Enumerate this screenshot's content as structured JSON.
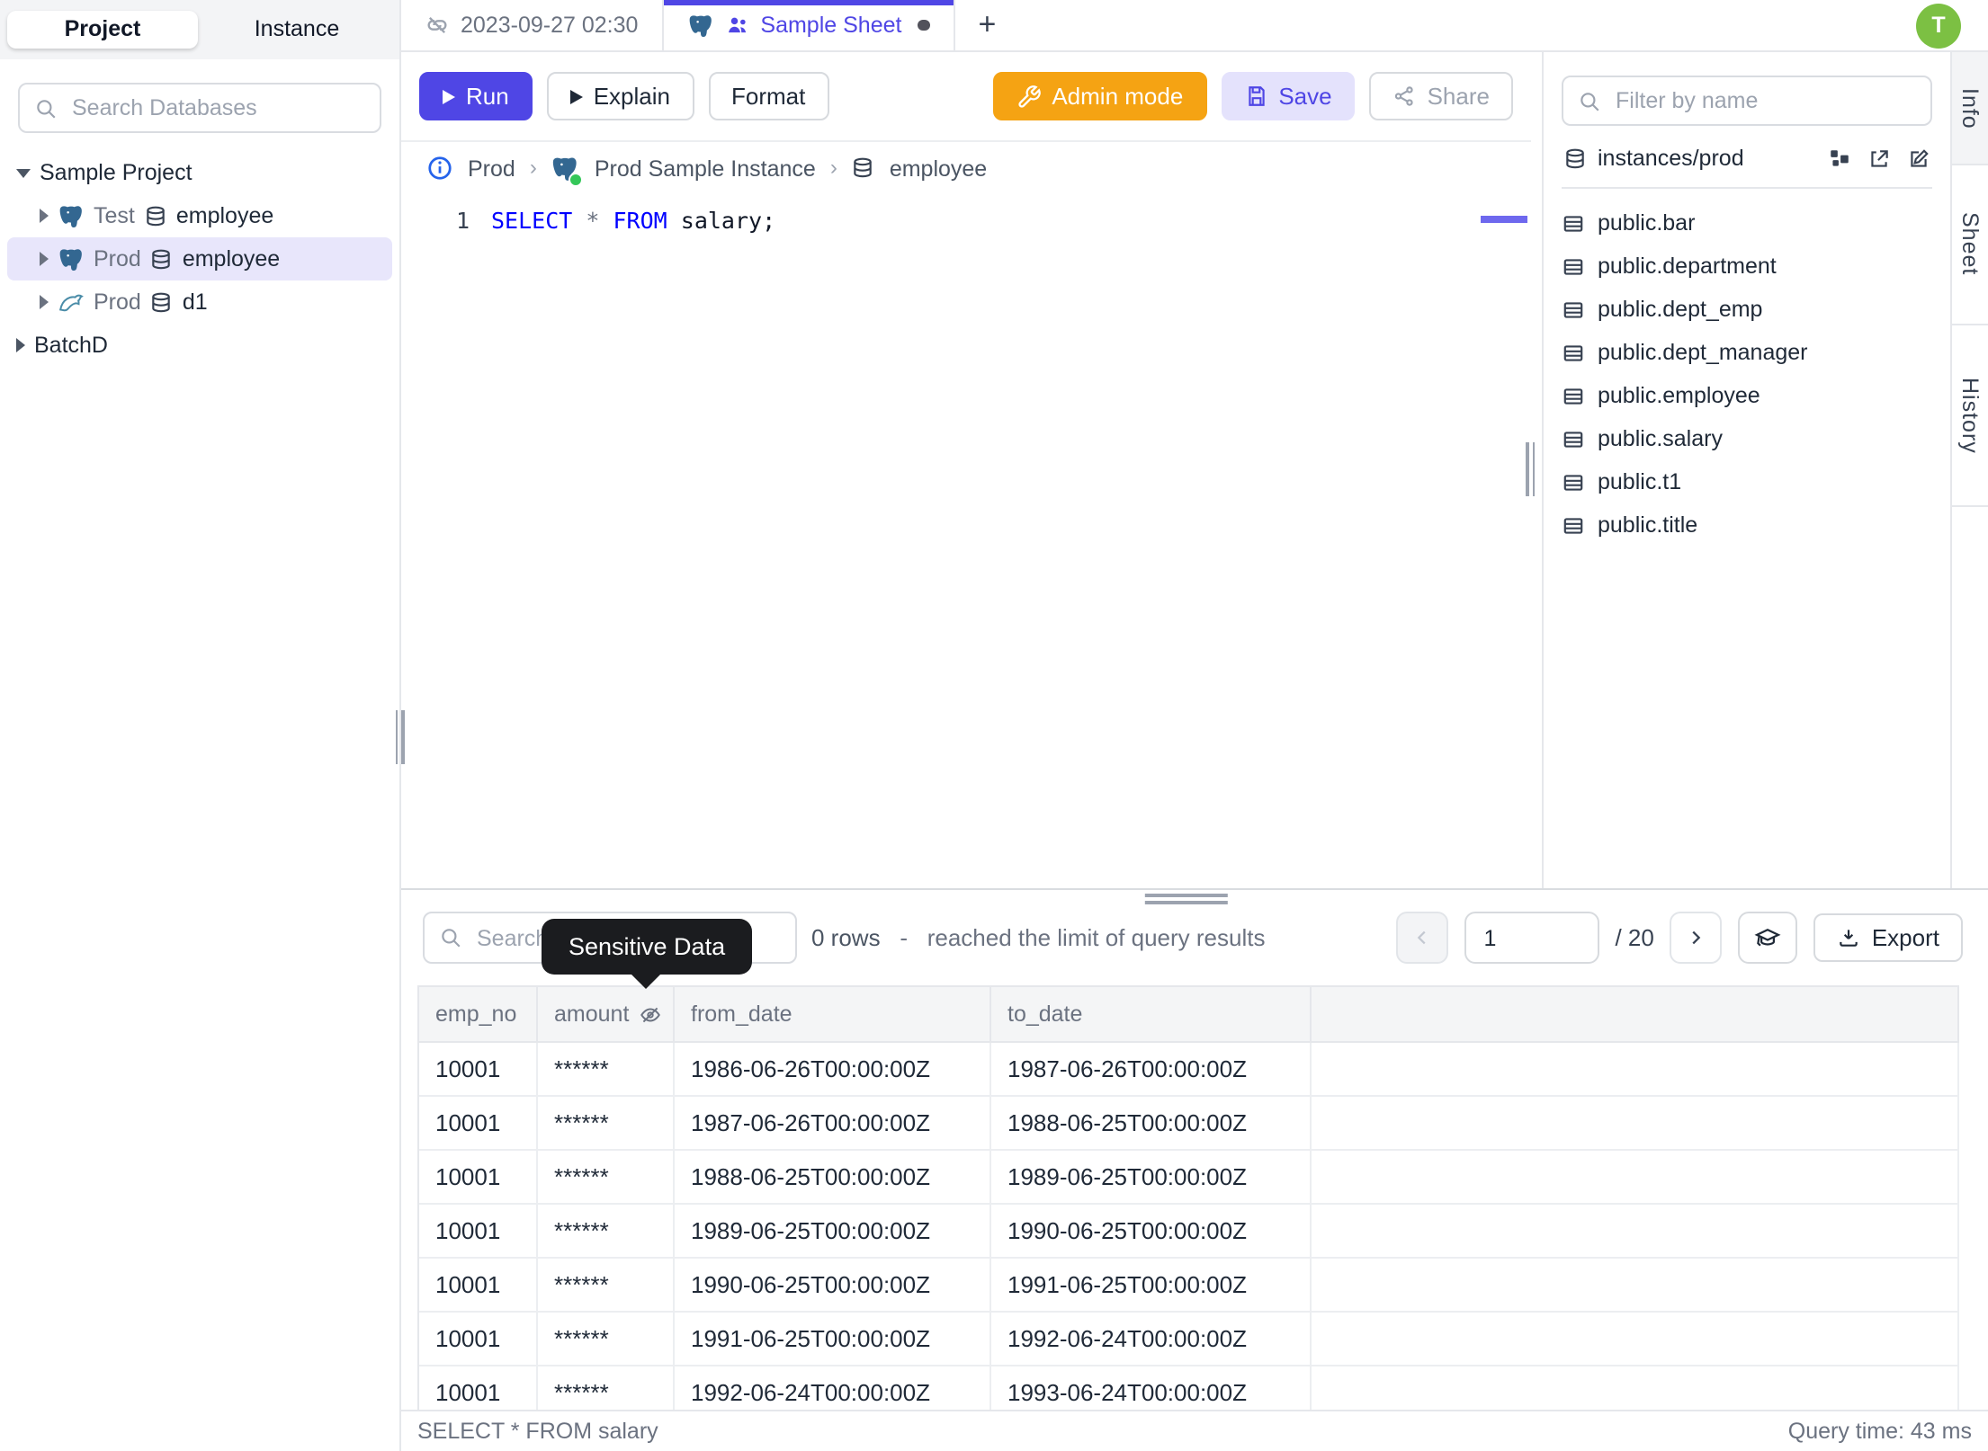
{
  "colors": {
    "accent": "#4f46e5",
    "admin_orange": "#f5a313",
    "avatar_green": "#7cc043",
    "keyword_blue": "#0000ff",
    "tooltip_bg": "#1b1c1f",
    "selected_row_bg": "#e8e6fb"
  },
  "sidebar": {
    "tabs": {
      "project": "Project",
      "instance": "Instance"
    },
    "search_placeholder": "Search Databases",
    "tree": {
      "project": "Sample Project",
      "items": [
        {
          "env": "Test",
          "db": "employee",
          "engine": "postgres"
        },
        {
          "env": "Prod",
          "db": "employee",
          "engine": "postgres"
        },
        {
          "env": "Prod",
          "db": "d1",
          "engine": "mysql"
        }
      ],
      "project2": "BatchD"
    }
  },
  "tabstrip": {
    "tab1": "2023-09-27 02:30",
    "tab2": "Sample Sheet",
    "new_tab": "+",
    "avatar": "T"
  },
  "toolbar": {
    "run": "Run",
    "explain": "Explain",
    "format": "Format",
    "admin": "Admin mode",
    "save": "Save",
    "share": "Share"
  },
  "breadcrumb": {
    "env": "Prod",
    "instance": "Prod Sample Instance",
    "database": "employee"
  },
  "editor": {
    "line": "1",
    "kw1": "SELECT",
    "star": "*",
    "kw2": "FROM",
    "rest": "salary;"
  },
  "right_panel": {
    "filter_placeholder": "Filter by name",
    "connection": "instances/prod",
    "tables": [
      "public.bar",
      "public.department",
      "public.dept_emp",
      "public.dept_manager",
      "public.employee",
      "public.salary",
      "public.t1",
      "public.title"
    ]
  },
  "side_tabs": {
    "info": "Info",
    "sheet": "Sheet",
    "history": "History"
  },
  "results": {
    "search_placeholder": "Search",
    "tooltip": "Sensitive Data",
    "rows_count": "0 rows",
    "dash": "-",
    "limit_text": "reached the limit of query results",
    "page": "1",
    "total": "/ 20",
    "export": "Export",
    "columns": [
      "emp_no",
      "amount",
      "from_date",
      "to_date"
    ],
    "rows": [
      [
        "10001",
        "******",
        "1986-06-26T00:00:00Z",
        "1987-06-26T00:00:00Z"
      ],
      [
        "10001",
        "******",
        "1987-06-26T00:00:00Z",
        "1988-06-25T00:00:00Z"
      ],
      [
        "10001",
        "******",
        "1988-06-25T00:00:00Z",
        "1989-06-25T00:00:00Z"
      ],
      [
        "10001",
        "******",
        "1989-06-25T00:00:00Z",
        "1990-06-25T00:00:00Z"
      ],
      [
        "10001",
        "******",
        "1990-06-25T00:00:00Z",
        "1991-06-25T00:00:00Z"
      ],
      [
        "10001",
        "******",
        "1991-06-25T00:00:00Z",
        "1992-06-24T00:00:00Z"
      ],
      [
        "10001",
        "******",
        "1992-06-24T00:00:00Z",
        "1993-06-24T00:00:00Z"
      ]
    ]
  },
  "statusbar": {
    "query": "SELECT * FROM salary",
    "time": "Query time: 43 ms"
  }
}
